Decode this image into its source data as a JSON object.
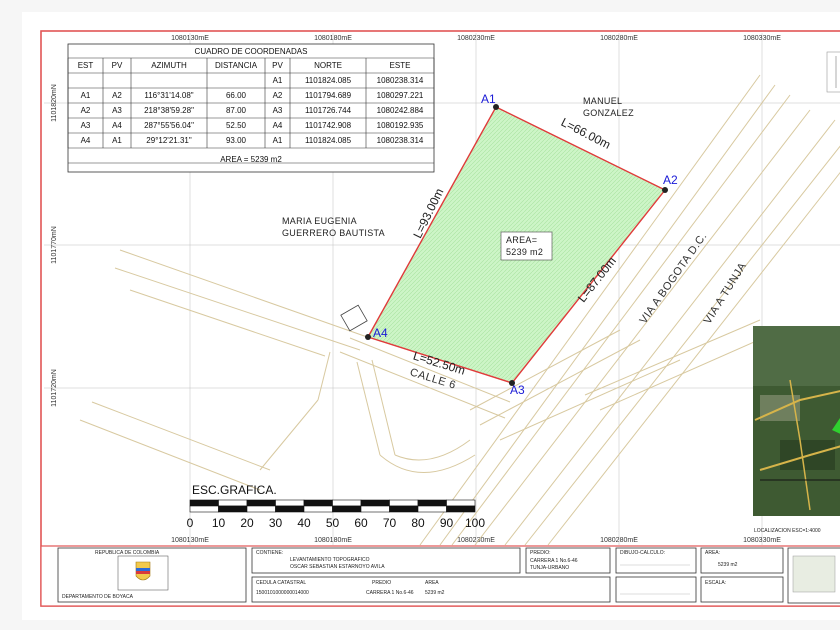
{
  "grid_labels": {
    "top": [
      "1080130mE",
      "1080180mE",
      "1080230mE",
      "1080280mE",
      "1080330mE"
    ],
    "bottom": [
      "1080130mE",
      "1080180mE",
      "1080230mE",
      "1080280mE",
      "1080330mE"
    ],
    "left": [
      "1101820mN",
      "1101770mN",
      "1101720mN"
    ]
  },
  "coord_table": {
    "title": "CUADRO DE COORDENADAS",
    "headers": [
      "EST",
      "PV",
      "AZIMUTH",
      "DISTANCIA",
      "PV",
      "NORTE",
      "ESTE"
    ],
    "first_row": [
      "",
      "",
      "",
      "",
      "A1",
      "1101824.085",
      "1080238.314"
    ],
    "rows": [
      [
        "A1",
        "A2",
        "116°31'14.08\"",
        "66.00",
        "A2",
        "1101794.689",
        "1080297.221"
      ],
      [
        "A2",
        "A3",
        "218°38'59.28\"",
        "87.00",
        "A3",
        "1101726.744",
        "1080242.884"
      ],
      [
        "A3",
        "A4",
        "287°55'56.04\"",
        "52.50",
        "A4",
        "1101742.908",
        "1080192.935"
      ],
      [
        "A4",
        "A1",
        "29°12'21.31\"",
        "93.00",
        "A1",
        "1101824.085",
        "1080238.314"
      ]
    ],
    "area": "AREA = 5239 m2"
  },
  "parcel": {
    "vertices": [
      "A1",
      "A2",
      "A3",
      "A4"
    ],
    "edges": [
      "L=66.00m",
      "L=87.00m",
      "L=52.50m",
      "L=93.00m"
    ],
    "area_title": "AREA=",
    "area_value": "5239 m2"
  },
  "owners": {
    "east_1": "MANUEL",
    "east_2": "GONZALEZ",
    "west_1": "MARIA EUGENIA",
    "west_2": "GUERRERO BAUTISTA"
  },
  "roads": {
    "via_bogota": "VIA A BOGOTA D.C.",
    "via_tunja": "VIA A TUNJA",
    "calle": "CALLE 6"
  },
  "scale": {
    "title": "ESC.GRAFICA.",
    "ticks": [
      "0",
      "10",
      "20",
      "30",
      "40",
      "50",
      "60",
      "70",
      "80",
      "90",
      "100"
    ]
  },
  "title_block": {
    "entity_1": "REPUBLICA DE COLOMBIA",
    "entity_2": "DEPARTAMENTO DE BOYACA",
    "contains_label": "CONTIENE:",
    "contains_1": "LEVANTAMIENTO TOPOGRAFICO",
    "contains_2": "OSCAR SEBASTIAN ESTARNOYO AVILA",
    "predio_label": "PREDIO:",
    "predio_1": "CARRERA 1 No.6-46",
    "predio_2": "TUNJA-URBANO",
    "dibujo_label": "DIBUJO-CALCULO:",
    "area_label": "AREA:",
    "area_value": "5239 m2",
    "cedula_label": "CEDULA CATASTRAL",
    "predio2_label": "PREDIO",
    "area2_label": "AREA",
    "cedula_value": "1500101000000014000",
    "predio2_value": "CARRERA 1 No.6-46",
    "area2_value": "5239 m2",
    "escala_label": "ESCALA:",
    "localizacion": "LOCALIZACION ESC=1:4000"
  },
  "colors": {
    "parcel_fill": "#cdf5c7",
    "parcel_border": "#e03a3a",
    "road_lines": "#d8c9a0",
    "vertex_label": "#1a1ad6"
  }
}
